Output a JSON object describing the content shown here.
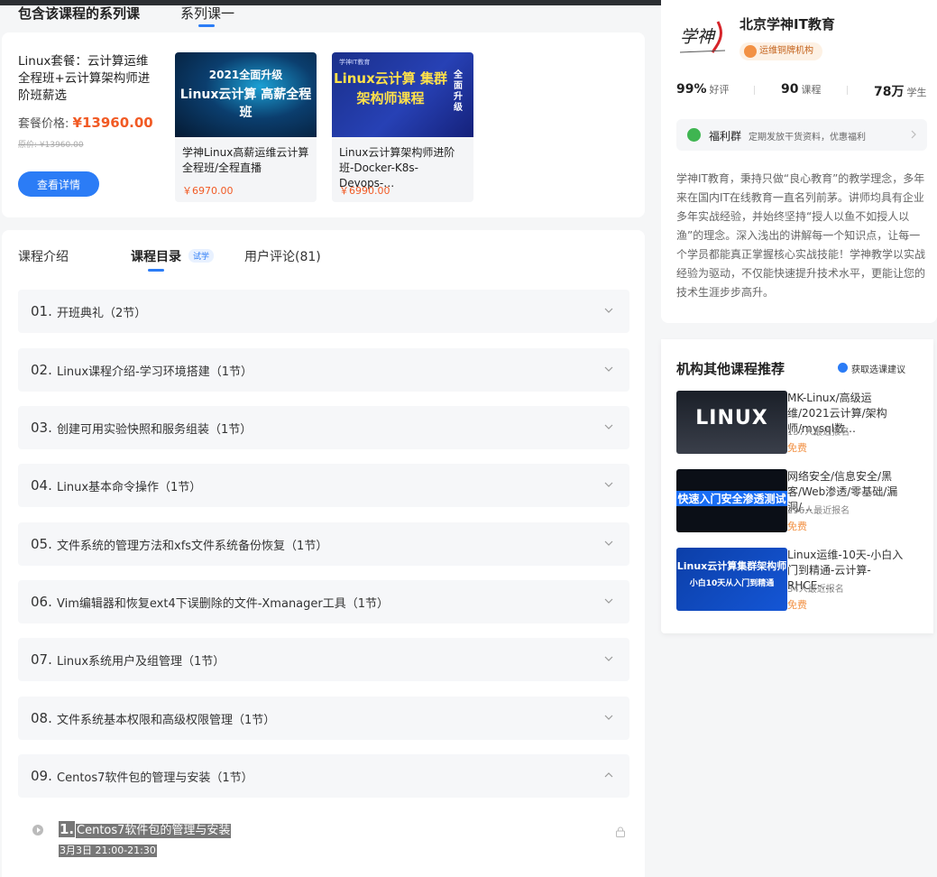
{
  "series": {
    "header_title": "包含该课程的系列课",
    "tab_label": "系列课一",
    "package_title": "Linux套餐：云计算运维全程班+云计算架构师进阶班薪选",
    "price_label": "套餐价格:",
    "price": "¥13960.00",
    "original_price": "原价: ¥13960.00",
    "detail_button": "查看详情",
    "courses": [
      {
        "thumb_top": "2021全面升级",
        "thumb_big": "Linux云计算 高薪全程班",
        "name": "学神Linux高薪运维云计算全程班/全程直播",
        "price": "￥6970.00"
      },
      {
        "thumb_top": "学神IT教育",
        "thumb_big": "Linux云计算 集群架构师课程",
        "thumb_side": "全面升级",
        "name": "Linux云计算架构师进阶班-Docker-K8s-Devops-…",
        "price": "￥6990.00"
      }
    ]
  },
  "catalog": {
    "tabs": {
      "intro": "课程介绍",
      "catalog": "课程目录",
      "trial_badge": "试学",
      "reviews": "用户评论(81)"
    },
    "chapters": [
      {
        "num": "01.",
        "title": "开班典礼（2节）"
      },
      {
        "num": "02.",
        "title": "Linux课程介绍-学习环境搭建（1节）"
      },
      {
        "num": "03.",
        "title": "创建可用实验快照和服务组装（1节）"
      },
      {
        "num": "04.",
        "title": "Linux基本命令操作（1节）"
      },
      {
        "num": "05.",
        "title": "文件系统的管理方法和xfs文件系统备份恢复（1节）"
      },
      {
        "num": "06.",
        "title": "Vim编辑器和恢复ext4下误删除的文件-Xmanager工具（1节）"
      },
      {
        "num": "07.",
        "title": "Linux系统用户及组管理（1节）"
      },
      {
        "num": "08.",
        "title": "文件系统基本权限和高级权限管理（1节）"
      },
      {
        "num": "09.",
        "title": "Centos7软件包的管理与安装（1节）"
      }
    ],
    "lesson": {
      "num": "1.",
      "title": "Centos7软件包的管理与安装",
      "time": "3月3日 21:00-21:30"
    }
  },
  "org": {
    "logo_text": "学神",
    "name": "北京学神IT教育",
    "badge": "运维铜牌机构",
    "stats": {
      "rating_value": "99%",
      "rating_label": "好评",
      "courses_value": "90",
      "courses_label": "课程",
      "students_value": "78万",
      "students_label": "学生"
    },
    "welfare_label": "福利群",
    "welfare_desc": "定期发放干货资料，优惠福利",
    "description": "学神IT教育，秉持只做“良心教育”的教学理念，多年来在国内IT在线教育一直名列前茅。讲师均具有企业多年实战经验，并始终坚持“授人以鱼不如授人以渔”的理念。深入浅出的讲解每一个知识点，让每一个学员都能真正掌握核心实战技能！学神教学以实战经验为驱动，不仅能快速提升技术水平，更能让您的技术生涯步步高升。"
  },
  "recommend": {
    "title": "机构其他课程推荐",
    "advice": "获取选课建议",
    "items": [
      {
        "thumb_text": "LINUX",
        "name": "MK-Linux/高级运维/2021云计算/架构师/mysql数…",
        "count": "157人最近报名",
        "price": "免费"
      },
      {
        "thumb_text": "快速入门安全渗透测试",
        "name": "网络安全/信息安全/黑客/Web渗透/零基础/漏洞/…",
        "count": "296人最近报名",
        "price": "免费"
      },
      {
        "thumb_text": "Linux云计算集群架构师",
        "thumb_sub": "小白10天从入门到精通",
        "name": "Linux运维-10天-小白入门到精通-云计算-RHCE-…",
        "count": "34人最近报名",
        "price": "免费"
      }
    ]
  },
  "colors": {
    "accent": "#2b7cf6",
    "price": "#f15a24",
    "free": "#f29144"
  }
}
